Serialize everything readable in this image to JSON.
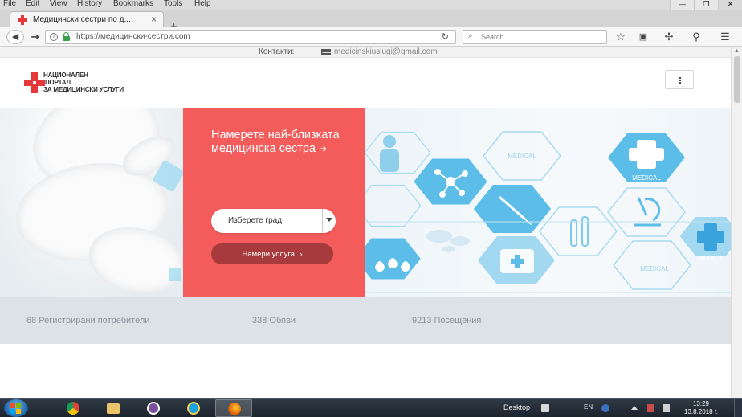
{
  "browser": {
    "menu": [
      "File",
      "Edit",
      "View",
      "History",
      "Bookmarks",
      "Tools",
      "Help"
    ],
    "window_controls": [
      "—",
      "❐",
      "✕"
    ],
    "tab_title": "Медицински сестри по д...",
    "tab_close": "×",
    "new_tab": "+",
    "url": "https://медицински-сестри.com",
    "search_placeholder": "Search",
    "icons": [
      "back-icon",
      "forward-icon",
      "info-icon",
      "lock-icon",
      "reload-icon",
      "search-icon",
      "bookmark-star-icon",
      "library-icon",
      "pocket-icon",
      "find-icon",
      "hamburger-menu-icon"
    ]
  },
  "page": {
    "contact_label": "Контакти:",
    "contact_email": "medicinskiuslugi@gmail.com",
    "logo_lines": [
      "НАЦИОНАЛЕН",
      "ПОРТАЛ",
      "ЗА МЕДИЦИНСКИ УСЛУГИ"
    ],
    "hero_heading": "Намерете най-близката медицинска сестра",
    "hero_arrow": "➔",
    "city_select_value": "Изберете град",
    "find_button_label": "Намери услуга",
    "find_button_arrow": "›",
    "hex_labels": [
      "MEDICAL",
      "MEDICAL",
      "MEDICAL",
      "MEDICAL"
    ],
    "stats": [
      "68 Регистрирани потребители",
      "338 Обяви",
      "9213 Посещения"
    ],
    "colors": {
      "accent_red": "#f45b5b",
      "button_dark_red": "#a63a3c",
      "hex_blue": "#4fb3e8"
    }
  },
  "taskbar": {
    "desktop_label": "Desktop",
    "language": "EN",
    "time": "13:29",
    "date": "13.8.2018 г.",
    "apps": [
      "chrome-icon",
      "file-explorer-icon",
      "viber-icon",
      "internet-explorer-icon",
      "firefox-icon"
    ]
  }
}
